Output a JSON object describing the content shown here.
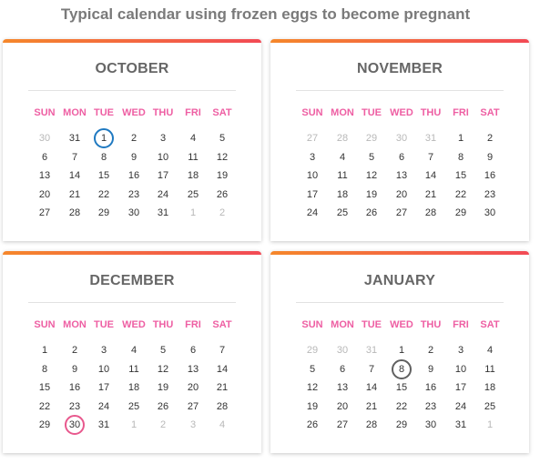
{
  "title": "Typical calendar using frozen eggs to become pregnant",
  "weekdays": [
    "SUN",
    "MON",
    "TUE",
    "WED",
    "THU",
    "FRI",
    "SAT"
  ],
  "colors": {
    "bar_start": "#f5872b",
    "bar_end": "#f24a55",
    "weekday": "#ee5fa3",
    "ring_blue": "#1f79c1",
    "ring_pink": "#e8588d",
    "ring_gray": "#606060"
  },
  "months": [
    {
      "name": "OCTOBER",
      "weeks": [
        [
          "30",
          "31",
          "1",
          "2",
          "3",
          "4",
          "5"
        ],
        [
          "6",
          "7",
          "8",
          "9",
          "10",
          "11",
          "12"
        ],
        [
          "13",
          "14",
          "15",
          "16",
          "17",
          "18",
          "19"
        ],
        [
          "20",
          "21",
          "22",
          "23",
          "24",
          "25",
          "26"
        ],
        [
          "27",
          "28",
          "29",
          "30",
          "31",
          "1",
          "2"
        ]
      ],
      "faded": [
        [
          0,
          0
        ],
        [
          4,
          5
        ],
        [
          4,
          6
        ]
      ],
      "marked": [
        {
          "week": 0,
          "day": 2,
          "ring": "ring_blue"
        }
      ]
    },
    {
      "name": "NOVEMBER",
      "weeks": [
        [
          "27",
          "28",
          "29",
          "30",
          "31",
          "1",
          "2"
        ],
        [
          "3",
          "4",
          "5",
          "6",
          "7",
          "8",
          "9"
        ],
        [
          "10",
          "11",
          "12",
          "13",
          "14",
          "15",
          "16"
        ],
        [
          "17",
          "18",
          "19",
          "20",
          "21",
          "22",
          "23"
        ],
        [
          "24",
          "25",
          "26",
          "27",
          "28",
          "29",
          "30"
        ]
      ],
      "faded": [
        [
          0,
          0
        ],
        [
          0,
          1
        ],
        [
          0,
          2
        ],
        [
          0,
          3
        ],
        [
          0,
          4
        ]
      ],
      "marked": []
    },
    {
      "name": "DECEMBER",
      "weeks": [
        [
          "1",
          "2",
          "3",
          "4",
          "5",
          "6",
          "7"
        ],
        [
          "8",
          "9",
          "10",
          "11",
          "12",
          "13",
          "14"
        ],
        [
          "15",
          "16",
          "17",
          "18",
          "19",
          "20",
          "21"
        ],
        [
          "22",
          "23",
          "24",
          "25",
          "26",
          "27",
          "28"
        ],
        [
          "29",
          "30",
          "31",
          "1",
          "2",
          "3",
          "4"
        ]
      ],
      "faded": [
        [
          4,
          3
        ],
        [
          4,
          4
        ],
        [
          4,
          5
        ],
        [
          4,
          6
        ]
      ],
      "marked": [
        {
          "week": 4,
          "day": 1,
          "ring": "ring_pink"
        }
      ]
    },
    {
      "name": "JANUARY",
      "weeks": [
        [
          "29",
          "30",
          "31",
          "1",
          "2",
          "3",
          "4"
        ],
        [
          "5",
          "6",
          "7",
          "8",
          "9",
          "10",
          "11"
        ],
        [
          "12",
          "13",
          "14",
          "15",
          "16",
          "17",
          "18"
        ],
        [
          "19",
          "20",
          "21",
          "22",
          "23",
          "24",
          "25"
        ],
        [
          "26",
          "27",
          "28",
          "29",
          "30",
          "31",
          "1"
        ]
      ],
      "faded": [
        [
          0,
          0
        ],
        [
          0,
          1
        ],
        [
          0,
          2
        ],
        [
          4,
          6
        ]
      ],
      "marked": [
        {
          "week": 1,
          "day": 3,
          "ring": "ring_gray"
        }
      ]
    }
  ]
}
